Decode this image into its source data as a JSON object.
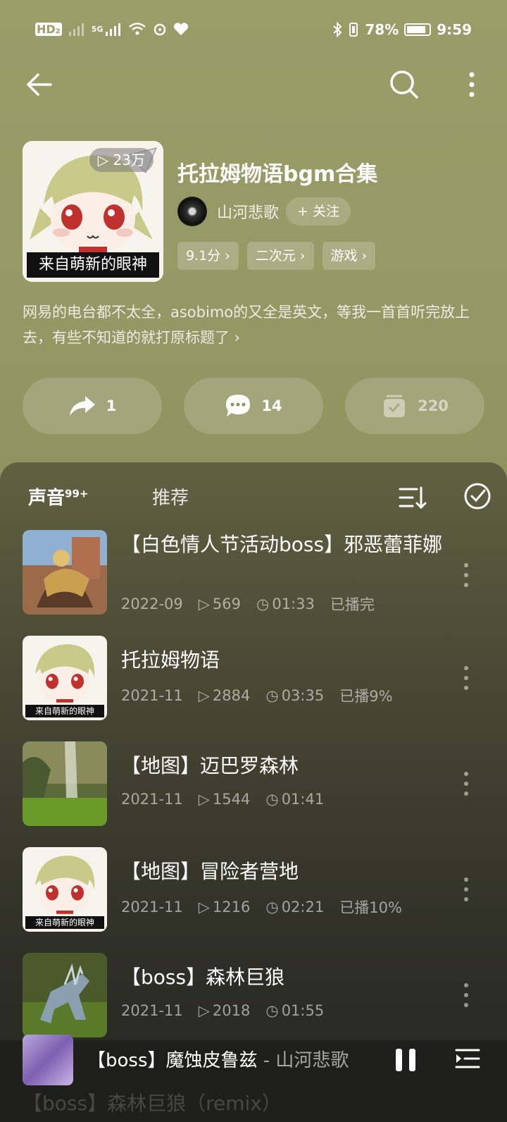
{
  "status_bar": {
    "network_left": "HD₂",
    "signal_5g": "5G",
    "battery_percent": "78%",
    "time": "9:59"
  },
  "app_bar": {
    "back_icon": "arrow-left-icon",
    "search_icon": "search-icon",
    "more_icon": "more-vertical-icon"
  },
  "playlist": {
    "cover_play_count": "23万",
    "cover_caption": "来自萌新的眼神",
    "title": "托拉姆物语bgm合集",
    "creator_name": "山河悲歌",
    "follow_label": "+ 关注",
    "tags": [
      "9.1分 ›",
      "二次元 ›",
      "游戏 ›"
    ],
    "description": "网易的电台都不太全，asobimo的又全是英文，等我一首首听完放上去，有些不知道的就打原标题了 ›"
  },
  "actions": {
    "share_count": "1",
    "comment_count": "14",
    "collect_count": "220"
  },
  "tabs": {
    "sound_label": "声音",
    "sound_badge": "99+",
    "recommend_label": "推荐"
  },
  "tracks": [
    {
      "title": "【白色情人节活动boss】邪恶蕾菲娜",
      "date": "2022-09",
      "plays": "569",
      "duration": "01:33",
      "status": "已播完",
      "thumb": "game-scene-warrior"
    },
    {
      "title": "托拉姆物语",
      "date": "2021-11",
      "plays": "2884",
      "duration": "03:35",
      "status": "已播9%",
      "thumb": "anime-girl-cover"
    },
    {
      "title": "【地图】迈巴罗森林",
      "date": "2021-11",
      "plays": "1544",
      "duration": "01:41",
      "status": "",
      "thumb": "forest-waterfall"
    },
    {
      "title": "【地图】冒险者营地",
      "date": "2021-11",
      "plays": "1216",
      "duration": "02:21",
      "status": "已播10%",
      "thumb": "anime-girl-cover"
    },
    {
      "title": "【boss】森林巨狼",
      "date": "2021-11",
      "plays": "2018",
      "duration": "01:55",
      "status": "",
      "thumb": "forest-wolf"
    }
  ],
  "thumb_caption": "来自萌新的眼神",
  "player": {
    "title": "【boss】魔蚀皮鲁兹",
    "artist": " - 山河悲歌",
    "ghost_text": "【boss】森林巨狼（remix）"
  }
}
